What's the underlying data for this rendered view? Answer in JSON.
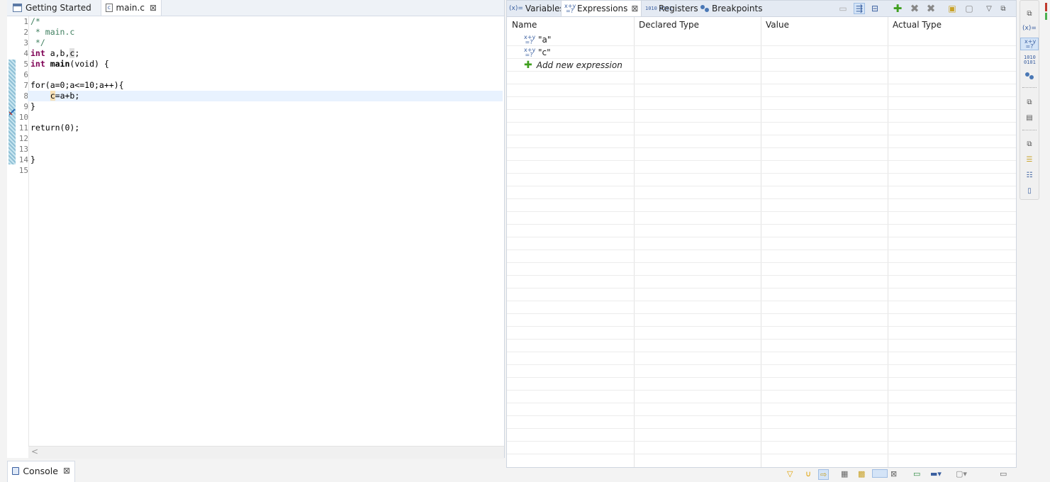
{
  "editor": {
    "tabs": [
      {
        "label": "Getting Started",
        "icon": "page-icon"
      },
      {
        "label": "main.c",
        "icon": "c-file-icon",
        "active": true
      }
    ],
    "line_numbers": [
      "1",
      "2",
      "3",
      "4",
      "5",
      "6",
      "7",
      "8",
      "9",
      "10",
      "11",
      "12",
      "13",
      "14",
      "15"
    ],
    "lines": {
      "l1": "/*",
      "l2": " * main.c",
      "l3": " */",
      "l4_kw": "int",
      "l4_rest": " a,b,",
      "l4_c": "c",
      "l4_end": ";",
      "l5_kw": "int",
      "l5_fn": " main",
      "l5_rest": "(void) {",
      "l7": "for(a=0;a<=10;a++){",
      "l8_c": "c",
      "l8_rest": "=a+b;",
      "l9": "}",
      "l11": "return(0);",
      "l14": "}"
    },
    "scroll_arrow": "<"
  },
  "console": {
    "label": "Console"
  },
  "debug_views": {
    "tabs": [
      {
        "label": "Variables",
        "prefix": "(x)="
      },
      {
        "label": "Expressions",
        "active": true
      },
      {
        "label": "Registers",
        "prefix": "1010 0101"
      },
      {
        "label": "Breakpoints"
      }
    ],
    "close_symbol": "⊠",
    "columns": [
      "Name",
      "Declared Type",
      "Value",
      "Actual Type"
    ],
    "expressions": [
      {
        "name": "\"a\"",
        "icon": "expression-icon"
      },
      {
        "name": "\"c\"",
        "icon": "expression-icon"
      }
    ],
    "add_new": "Add new expression",
    "expr_icon_text": {
      "top": "x+y",
      "bottom": "=?"
    }
  },
  "right_toolbar": {
    "variables_label": "(x)="
  },
  "colors": {
    "keyword": "#7f0055",
    "comment": "#3f7f5f",
    "current_line": "#e8f2fe",
    "accent": "#3a5fa0",
    "add_green": "#3f9f1f"
  }
}
